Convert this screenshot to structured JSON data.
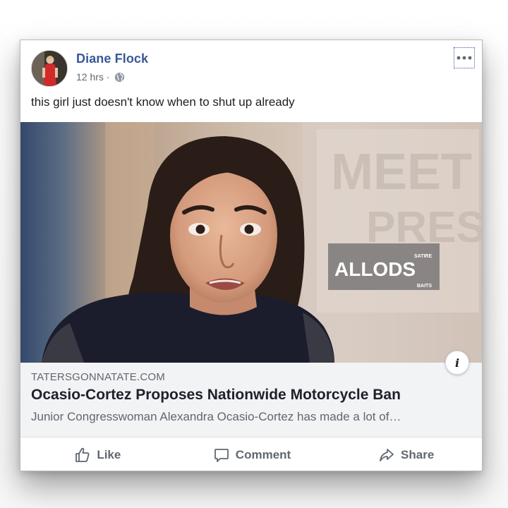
{
  "post": {
    "author": "Diane Flock",
    "time": "12 hrs",
    "separator": "·",
    "text": "this girl just doesn't know when to shut up already"
  },
  "image": {
    "background_text_1": "MEET",
    "background_text_2": "PRESS",
    "watermark": "ALLODS",
    "watermark_small_top": "SATIRE",
    "watermark_small_bottom": "BAITS"
  },
  "link": {
    "domain": "TATERSGONNATATE.COM",
    "title": "Ocasio-Cortez Proposes Nationwide Motorcycle Ban",
    "description": "Junior Congresswoman Alexandra Ocasio-Cortez has made a lot of…"
  },
  "actions": {
    "like": "Like",
    "comment": "Comment",
    "share": "Share"
  },
  "icons": {
    "globe": "globe-icon",
    "more": "more-options-icon",
    "info": "info-icon",
    "like": "thumbs-up-icon",
    "comment": "comment-icon",
    "share": "share-arrow-icon"
  },
  "colors": {
    "author": "#385898",
    "secondary_text": "#606770",
    "preview_bg": "#f2f3f5"
  }
}
